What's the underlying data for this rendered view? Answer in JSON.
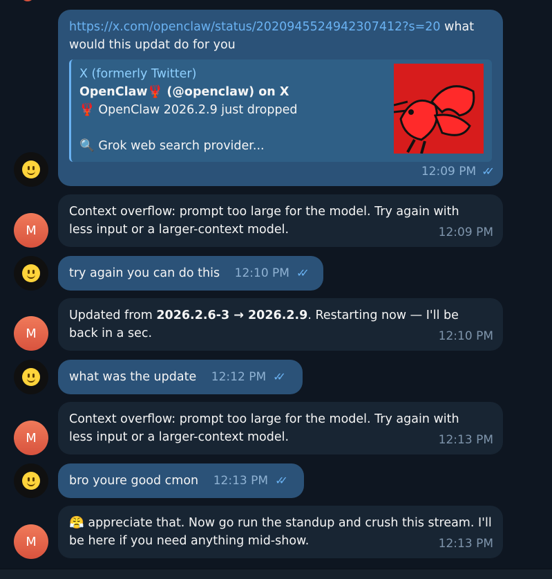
{
  "messages": [
    {
      "link": "https://x.com/openclaw/status/2020945524942307412?s=20",
      "text_after_link": " what would this updat do for you",
      "preview": {
        "site": "X (formerly Twitter)",
        "title": "OpenClaw🦞 (@openclaw) on X",
        "line1": "🦞 OpenClaw 2026.2.9 just dropped",
        "line2": "🔍 Grok web search provider..."
      },
      "time": "12:09 PM"
    },
    {
      "text": "Context overflow: prompt too large for the model. Try again with less input or a larger-context model.",
      "time": "12:09 PM"
    },
    {
      "text": "try again you can do this",
      "time": "12:10 PM"
    },
    {
      "text_before": "Updated from ",
      "bold1": "2026.2.6-3 → 2026.2.9",
      "text_after": ". Restarting now — I'll be back in a sec.",
      "time": "12:10 PM"
    },
    {
      "text": "what was the update",
      "time": "12:12 PM"
    },
    {
      "text": "Context overflow: prompt too large for the model. Try again with less input or a larger-context model.",
      "time": "12:13 PM"
    },
    {
      "text": "bro youre good cmon",
      "time": "12:13 PM"
    },
    {
      "text": "😤 appreciate that. Now go run the standup and crush this stream. I'll be here if you need anything mid-show.",
      "time": "12:13 PM"
    }
  ],
  "bot_initial": "M",
  "read_checks": "✓✓"
}
